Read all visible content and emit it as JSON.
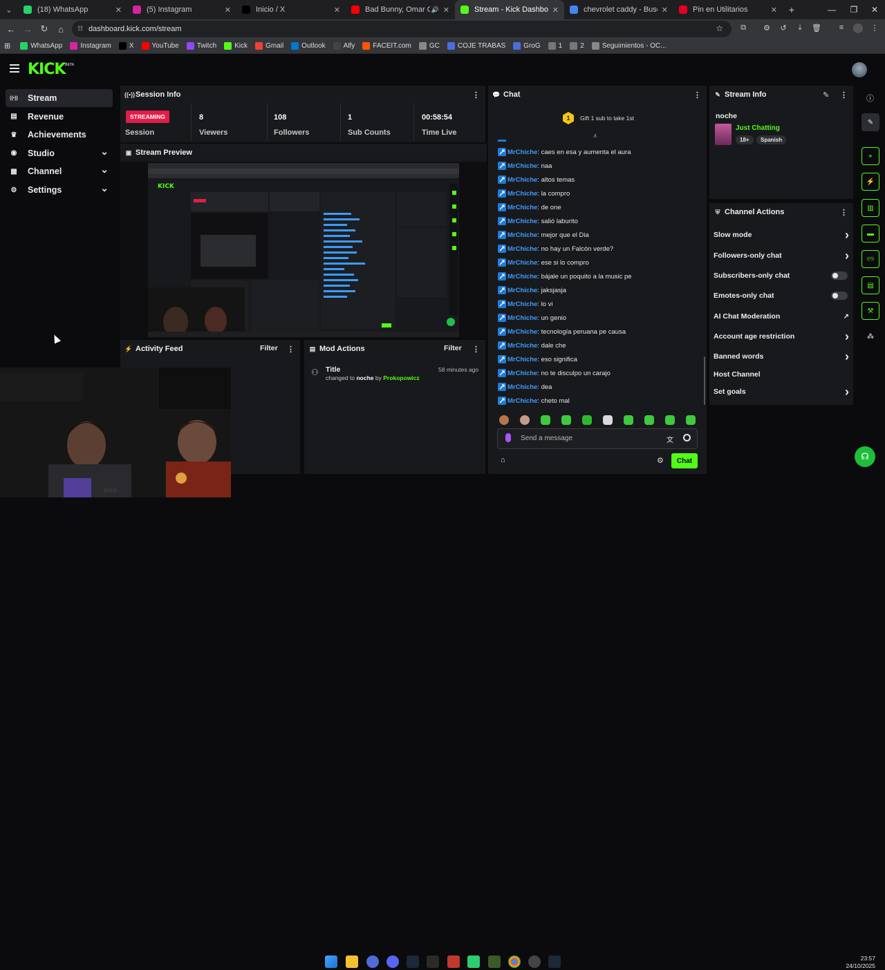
{
  "tabs": [
    {
      "label": "(18) WhatsApp",
      "icon": "whatsapp-icon",
      "color": "#25d366"
    },
    {
      "label": "(5) Instagram",
      "icon": "instagram-icon",
      "color": "#d6249f"
    },
    {
      "label": "Inicio / X",
      "icon": "x-icon",
      "color": "#000000"
    },
    {
      "label": "Bad Bunny, Omar Courtz, D",
      "icon": "youtube-icon",
      "color": "#ff0000"
    },
    {
      "label": "Stream - Kick Dashboard",
      "icon": "kick-icon",
      "color": "#53fc18"
    },
    {
      "label": "chevrolet caddy - Buscar con G",
      "icon": "google-icon",
      "color": "#4285f4"
    },
    {
      "label": "Pin en Utilitarios",
      "icon": "pinterest-icon",
      "color": "#e60023"
    }
  ],
  "address": {
    "url": "dashboard.kick.com/stream"
  },
  "bookmarks": [
    {
      "label": "WhatsApp",
      "color": "#25d366"
    },
    {
      "label": "Instagram",
      "color": "#d6249f"
    },
    {
      "label": "X",
      "color": "#000000"
    },
    {
      "label": "YouTube",
      "color": "#ff0000"
    },
    {
      "label": "Twitch",
      "color": "#9146ff"
    },
    {
      "label": "Kick",
      "color": "#53fc18"
    },
    {
      "label": "Gmail",
      "color": "#ea4335"
    },
    {
      "label": "Outlook",
      "color": "#0078d4"
    },
    {
      "label": "Alfy",
      "color": "#444444"
    },
    {
      "label": "FACEIT.com",
      "color": "#ff5500"
    },
    {
      "label": "GC",
      "color": "#888888"
    },
    {
      "label": "COJE TRABAS",
      "color": "#4a6ee0"
    },
    {
      "label": "GroG",
      "color": "#4a6ee0"
    },
    {
      "label": "1",
      "color": "#777777"
    },
    {
      "label": "2",
      "color": "#777777"
    },
    {
      "label": "Seguimientos - OC...",
      "color": "#888888"
    }
  ],
  "brand": {
    "logo": "KICK",
    "beta": "BETA",
    "accent": "#53fc18"
  },
  "sidebar": {
    "items": [
      {
        "label": "Stream",
        "icon": "broadcast-icon",
        "active": true
      },
      {
        "label": "Revenue",
        "icon": "revenue-icon"
      },
      {
        "label": "Achievements",
        "icon": "trophy-icon"
      },
      {
        "label": "Studio",
        "icon": "studio-icon",
        "expandable": true
      },
      {
        "label": "Channel",
        "icon": "channel-icon",
        "expandable": true
      },
      {
        "label": "Settings",
        "icon": "gear-icon",
        "expandable": true
      }
    ]
  },
  "session": {
    "title": "Session Info",
    "badge": "STREAMING",
    "badge_label": "Session",
    "stats": [
      {
        "value": "8",
        "label": "Viewers"
      },
      {
        "value": "108",
        "label": "Followers"
      },
      {
        "value": "1",
        "label": "Sub Counts"
      },
      {
        "value": "00:58:54",
        "label": "Time Live"
      }
    ]
  },
  "preview": {
    "title": "Stream Preview"
  },
  "activity": {
    "title": "Activity Feed",
    "filter": "Filter"
  },
  "mod": {
    "title": "Mod Actions",
    "filter": "Filter",
    "entry": {
      "title": "Title",
      "prefix": "changed to",
      "value": "noche",
      "by": "by",
      "user": "Prokopowicz",
      "time": "58 minutes ago"
    }
  },
  "chat": {
    "title": "Chat",
    "gift_count": "1",
    "gift_text": "Gift 1 sub to take 1st",
    "messages": [
      {
        "user": "MrChiche",
        "text": ": caes en esa y aumenta el aura"
      },
      {
        "user": "MrChiche",
        "text": ": naa"
      },
      {
        "user": "MrChiche",
        "text": ": altos temas"
      },
      {
        "user": "MrChiche",
        "text": ": la compro"
      },
      {
        "user": "MrChiche",
        "text": ": de one"
      },
      {
        "user": "MrChiche",
        "text": ": salió laburito"
      },
      {
        "user": "MrChiche",
        "text": ": mejor que el Dia"
      },
      {
        "user": "MrChiche",
        "text": ": no hay un Falcón verde?"
      },
      {
        "user": "MrChiche",
        "text": ": ese si lo compro"
      },
      {
        "user": "MrChiche",
        "text": ": bájale un poquito a la music pe"
      },
      {
        "user": "MrChiche",
        "text": ": jaksjasja"
      },
      {
        "user": "MrChiche",
        "text": ": lo vi"
      },
      {
        "user": "MrChiche",
        "text": ": un genio"
      },
      {
        "user": "MrChiche",
        "text": ": tecnología peruana pe causa"
      },
      {
        "user": "MrChiche",
        "text": ": dale che"
      },
      {
        "user": "MrChiche",
        "text": ": eso significa"
      },
      {
        "user": "MrChiche",
        "text": ": no te disculpo un carajo"
      },
      {
        "user": "MrChiche",
        "text": ": dea"
      },
      {
        "user": "MrChiche",
        "text": ": cheto mal"
      }
    ],
    "input_placeholder": "Send a message",
    "send_label": "Chat"
  },
  "stream_info": {
    "title": "Stream Info",
    "stream_title": "noche",
    "category": "Just Chatting",
    "tags": [
      "18+",
      "Spanish"
    ]
  },
  "channel_actions": {
    "title": "Channel Actions",
    "items": [
      {
        "label": "Slow mode",
        "control": "arrow"
      },
      {
        "label": "Followers-only chat",
        "control": "arrow"
      },
      {
        "label": "Subscribers-only chat",
        "control": "toggle"
      },
      {
        "label": "Emotes-only chat",
        "control": "toggle"
      },
      {
        "label": "AI Chat Moderation",
        "control": "external"
      },
      {
        "label": "Account age restriction",
        "control": "arrow"
      },
      {
        "label": "Banned words",
        "control": "arrow"
      },
      {
        "label": "Host Channel",
        "control": "none"
      },
      {
        "label": "Set goals",
        "control": "arrow"
      }
    ]
  },
  "taskbar": {
    "time": "23:57",
    "date": "24/10/2025"
  }
}
